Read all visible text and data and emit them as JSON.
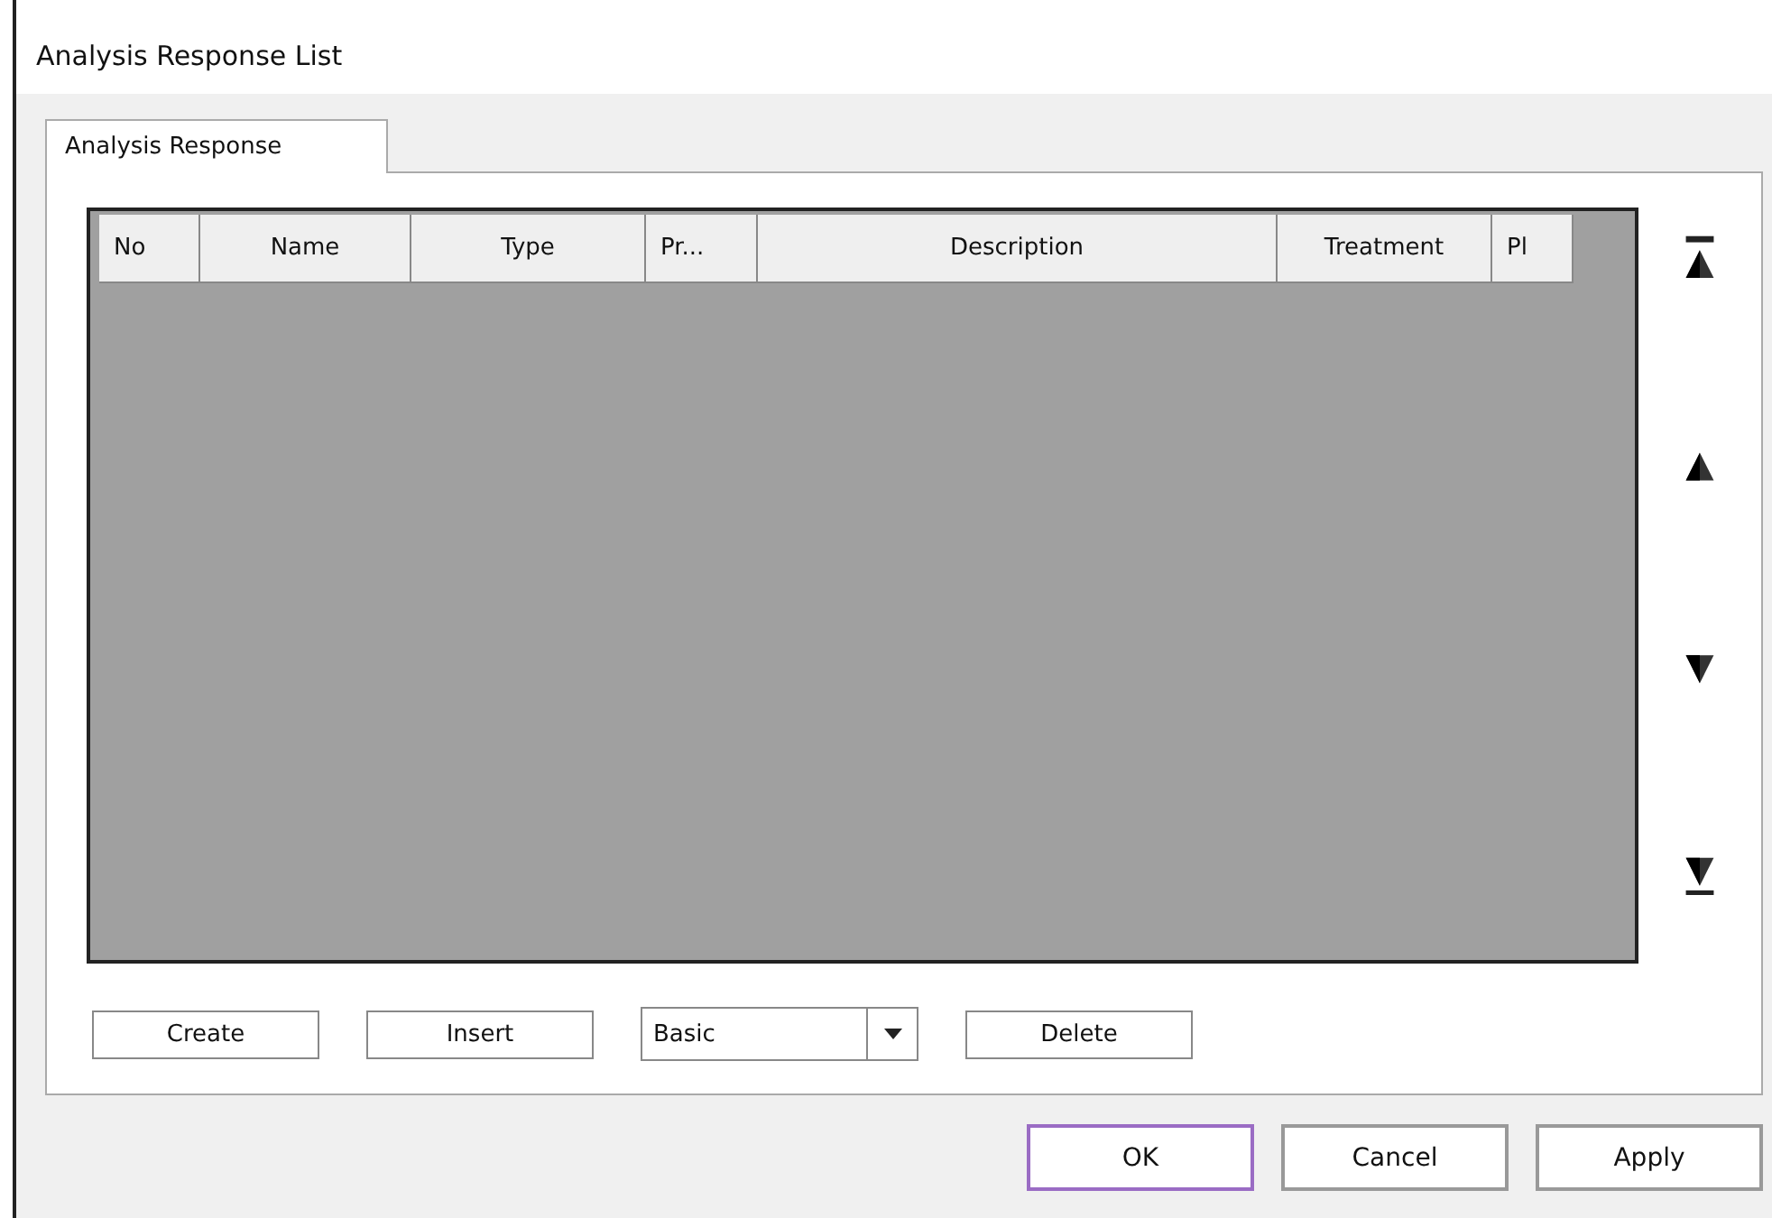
{
  "window": {
    "title": "Analysis Response List"
  },
  "tabs": [
    {
      "label": "Analysis Response",
      "selected": true
    }
  ],
  "table": {
    "columns": [
      "No",
      "Name",
      "Type",
      "Pr...",
      "Description",
      "Treatment",
      "Pl"
    ]
  },
  "move_buttons": [
    {
      "kind": "top"
    },
    {
      "kind": "up"
    },
    {
      "kind": "down"
    },
    {
      "kind": "bottom"
    }
  ],
  "actions": [
    {
      "kind": "button",
      "label": "Create"
    },
    {
      "kind": "button",
      "label": "Insert"
    },
    {
      "kind": "combo",
      "value": "Basic"
    },
    {
      "kind": "button",
      "label": "Delete"
    }
  ],
  "dialog_buttons": [
    {
      "label": "OK",
      "focused": true
    },
    {
      "label": "Cancel",
      "focused": false
    },
    {
      "label": "Apply",
      "focused": false
    }
  ]
}
